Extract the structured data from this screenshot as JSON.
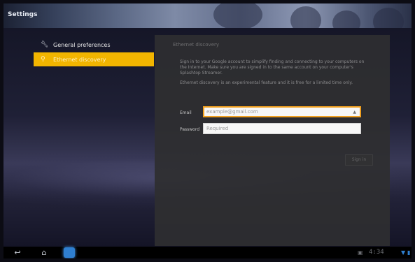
{
  "app": {
    "title": "Settings"
  },
  "sidebar": {
    "items": [
      {
        "label": "General preferences",
        "icon": "wrench-icon"
      },
      {
        "label": "Ethernet discovery",
        "icon": "network-icon"
      }
    ]
  },
  "panel": {
    "heading": "Ethernet discovery",
    "description": "Sign in to your Google account to simplify finding and connecting to your computers on the Internet. Make sure you are signed in to the same account on your computer's Splashtop Streamer.",
    "note": "Ethernet discovery is an experimental feature and it is free for a limited time only.",
    "email": {
      "label": "Email",
      "value": "example@gmail.com"
    },
    "password": {
      "label": "Password",
      "placeholder": "Required"
    },
    "signin_label": "Sign in"
  },
  "system_bar": {
    "clock": "4:34",
    "accent": "#2f7fd0"
  },
  "colors": {
    "selection": "#f2b500",
    "focus_border": "#f0a020"
  }
}
